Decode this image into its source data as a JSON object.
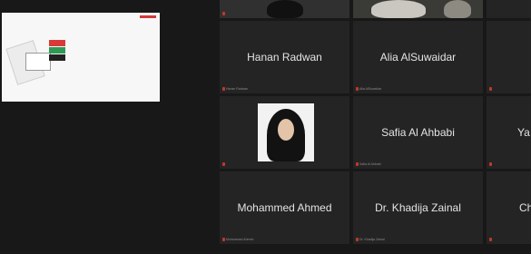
{
  "tiles": {
    "hanan": {
      "name": "Hanan Radwan",
      "label": "Hanan Radwan"
    },
    "alia": {
      "name": "Alia AlSuwaidar",
      "label": "Alia AlSuwaidar"
    },
    "safia": {
      "name": "Safia Al Ahbabi",
      "label": "Safia Al Ahbabi"
    },
    "mohammed": {
      "name": "Mohammed Ahmed",
      "label": "Mohammed Ahmed"
    },
    "khadija": {
      "name": "Dr. Khadija Zainal",
      "label": "Dr. Khadija Zainal"
    },
    "partial_right_mid": {
      "name": "Ya"
    },
    "partial_right_bottom": {
      "name": "Ch"
    }
  },
  "colors": {
    "background": "#181818",
    "tile": "#242424",
    "mic_muted": "#c0392b"
  }
}
